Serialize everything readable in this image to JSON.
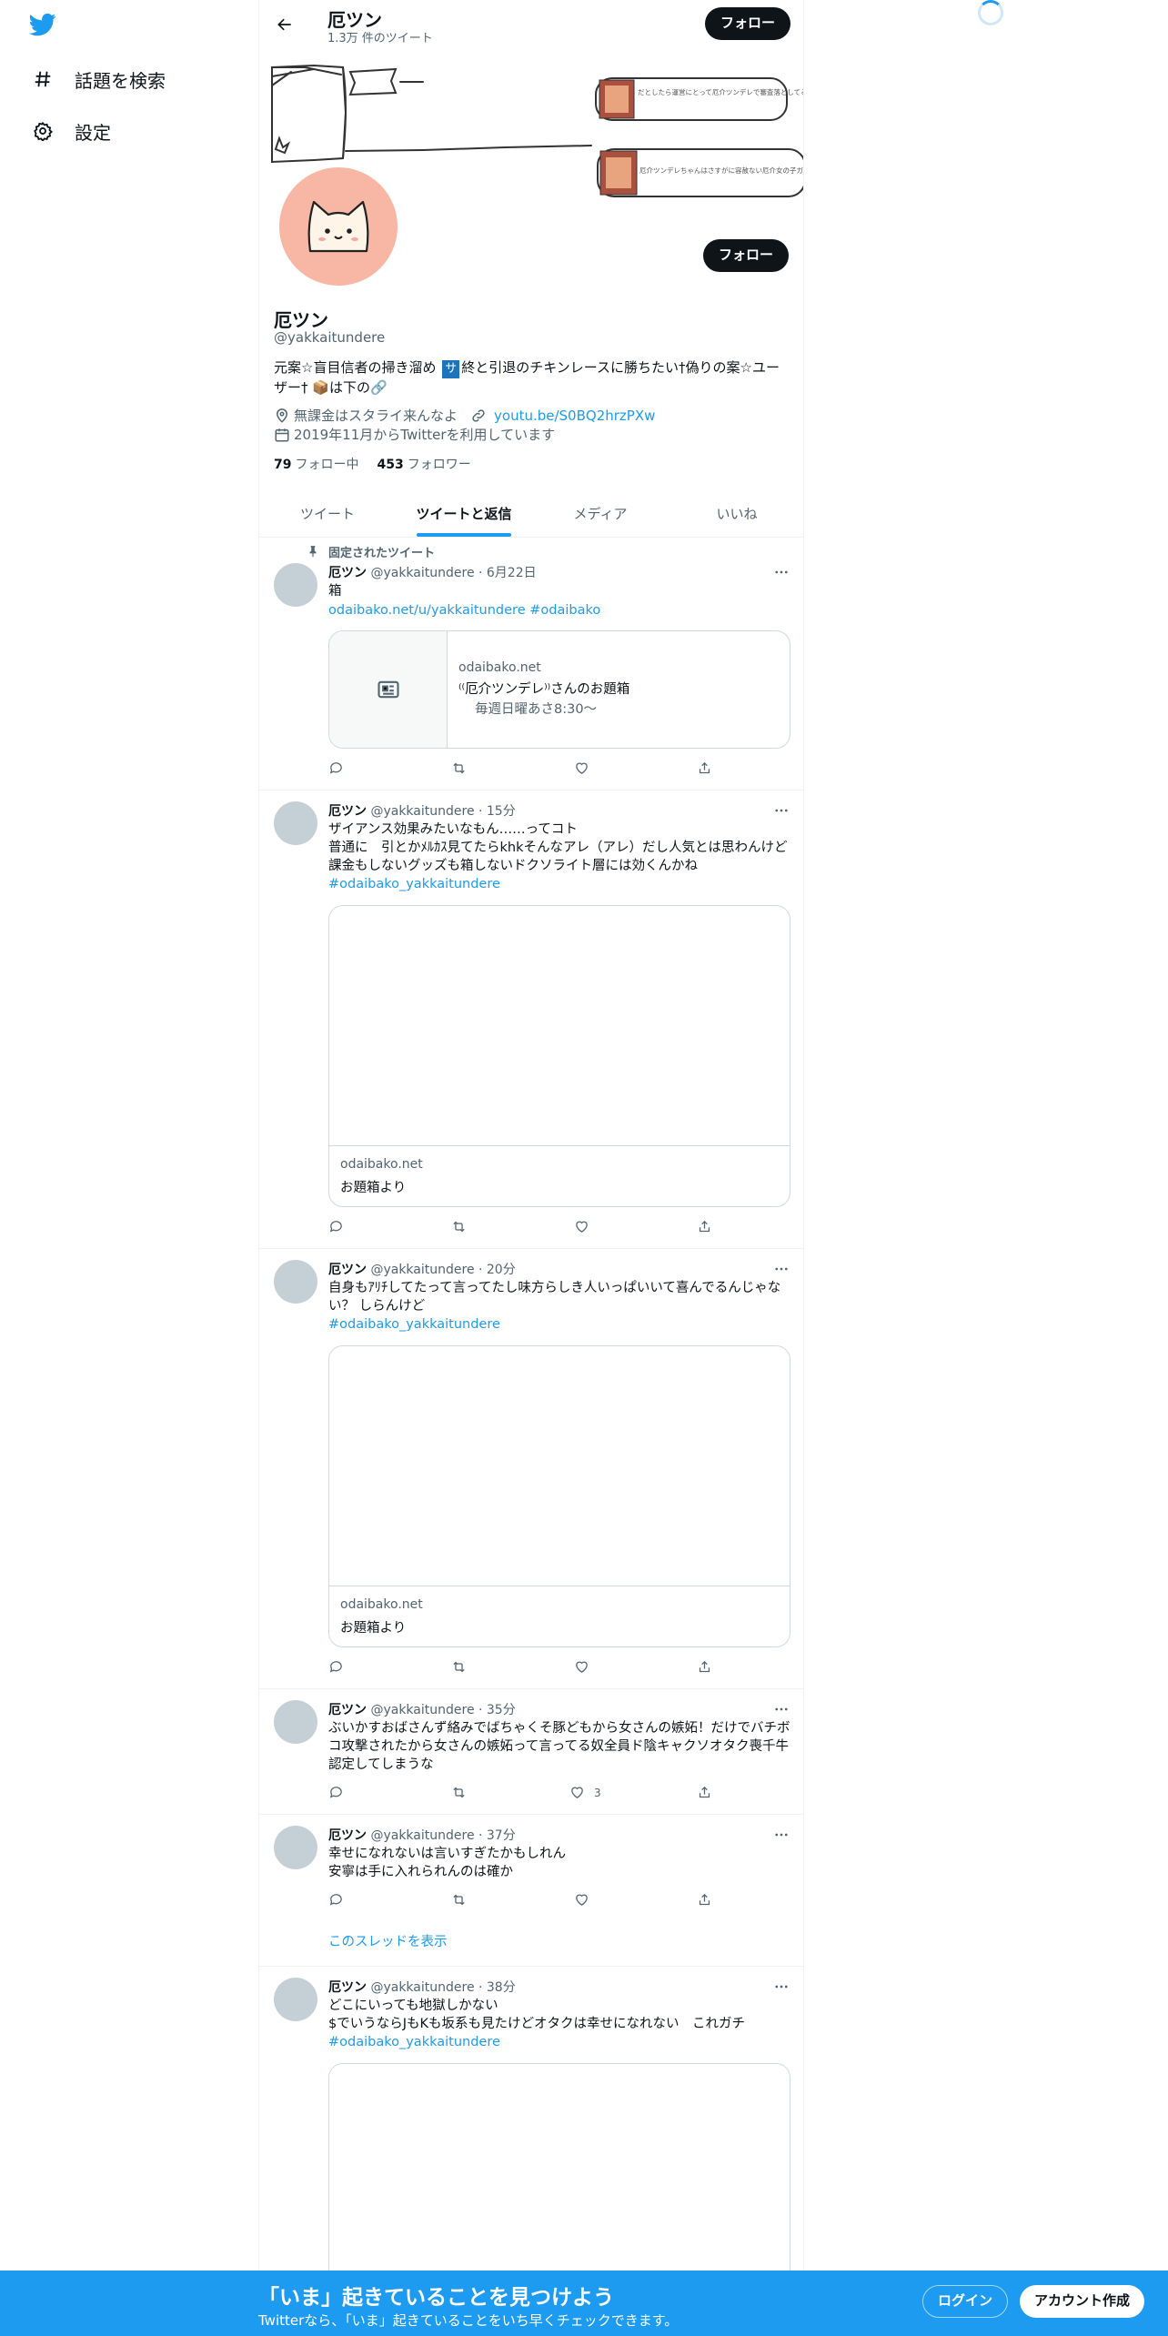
{
  "nav": {
    "items": [
      {
        "label": "話題を検索",
        "icon": "hashtag-icon"
      },
      {
        "label": "設定",
        "icon": "gear-icon"
      }
    ]
  },
  "header": {
    "name": "厄ツン",
    "tweet_count": "1.3万 件のツイート",
    "follow_label": "フォロー"
  },
  "banner": {
    "note1": "だとしたら運営にとって厄介ツンデレで審査落としてるから運営に媚はないか…笑",
    "note2": "厄介ツンデレちゃんはさすがに容赦ない厄介女の子ガチ仕様ですね"
  },
  "profile": {
    "name": "厄ツン",
    "handle": "@yakkaitundere",
    "bio_part1": "元案☆盲目信者の掃き溜め ",
    "bio_badge": "サ",
    "bio_part2": "終と引退のチキンレースに勝ちたい†偽りの案☆ユーザー† 📦は下の🔗",
    "location": "無課金はスタライ来んなよ",
    "url": "youtu.be/S0BQ2hrzPXw",
    "joined": "2019年11月からTwitterを利用しています",
    "following_count": "79",
    "following_label": "フォロー中",
    "followers_count": "453",
    "followers_label": "フォロワー",
    "follow_label": "フォロー"
  },
  "tabs": [
    {
      "label": "ツイート"
    },
    {
      "label": "ツイートと返信"
    },
    {
      "label": "メディア"
    },
    {
      "label": "いいね"
    }
  ],
  "tweets": [
    {
      "pinned_label": "固定されたツイート",
      "name": "厄ツン",
      "meta": "@yakkaitundere · 6月22日",
      "text": "箱",
      "link": "odaibako.net/u/yakkaitundere #odaibako",
      "card": {
        "domain": "odaibako.net",
        "title": "⁽⁽厄介ツンデレ⁾⁾さんのお題箱",
        "desc": "毎週日曜あさ8:30〜"
      }
    },
    {
      "name": "厄ツン",
      "meta": "@yakkaitundere · 15分",
      "text": "ザイアンス効果みたいなもん……ってコト\n普通に　引とかﾒﾙｶｽ見てたらkhkそんなアレ（アレ）だし人気とは思わんけど課金もしないグッズも箱しないドクソライト層には効くんかね",
      "link": "#odaibako_yakkaitundere",
      "card": {
        "domain": "odaibako.net",
        "title": "お題箱より"
      }
    },
    {
      "name": "厄ツン",
      "meta": "@yakkaitundere · 20分",
      "text": "自身もｱﾘﾁしてたって言ってたし味方らしき人いっぱいいて喜んでるんじゃない？ しらんけど",
      "link": "#odaibako_yakkaitundere",
      "card": {
        "domain": "odaibako.net",
        "title": "お題箱より"
      }
    },
    {
      "name": "厄ツン",
      "meta": "@yakkaitundere · 35分",
      "text": "ぶいかすおばさんず絡みでばちゃくそ豚どもから女さんの嫉妬！だけでバチボコ攻撃されたから女さんの嫉妬って言ってる奴全員ド陰キャクソオタク喪千牛認定してしまうな",
      "like_count": "3"
    },
    {
      "name": "厄ツン",
      "meta": "@yakkaitundere · 37分",
      "text": "幸せになれないは言いすぎたかもしれん\n安寧は手に入れられんのは確か",
      "thread_label": "このスレッドを表示"
    },
    {
      "name": "厄ツン",
      "meta": "@yakkaitundere · 38分",
      "text": "どこにいっても地獄しかない\n$でいうならJもKも坂系も見たけどオタクは幸せになれない　これガチ",
      "link": "#odaibako_yakkaitundere"
    }
  ],
  "bottom_bar": {
    "title": "「いま」起きていることを見つけよう",
    "subtitle": "Twitterなら、「いま」起きていることをいち早くチェックできます。",
    "login": "ログイン",
    "signup": "アカウント作成"
  },
  "colors": {
    "accent": "#1d9bf0",
    "text": "#0f1419",
    "secondary": "#536471",
    "avatar_bg": "#f8b7a4"
  }
}
